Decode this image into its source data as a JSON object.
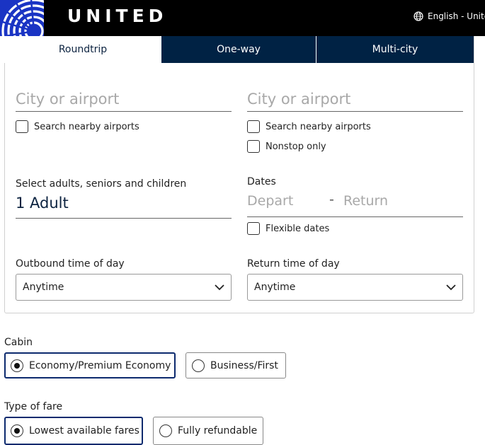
{
  "header": {
    "brand": "UNITED",
    "language": "English - United",
    "globe_icon": "globe-icon",
    "logo_icon": "united-globe-logo"
  },
  "colors": {
    "header_bg": "#000000",
    "logo_blue": "#1a34c4",
    "tab_inactive_bg": "#002244",
    "selected_border": "#0c2a6e",
    "placeholder": "#a8a8a8"
  },
  "tabs": [
    {
      "label": "Roundtrip",
      "active": true
    },
    {
      "label": "One-way",
      "active": false
    },
    {
      "label": "Multi-city",
      "active": false
    }
  ],
  "search": {
    "from": {
      "placeholder": "City or airport",
      "value": ""
    },
    "to": {
      "placeholder": "City or airport",
      "value": ""
    },
    "from_nearby": {
      "label": "Search nearby airports",
      "checked": false
    },
    "to_nearby": {
      "label": "Search nearby airports",
      "checked": false
    },
    "nonstop": {
      "label": "Nonstop only",
      "checked": false
    }
  },
  "travelers": {
    "label": "Select adults, seniors and children",
    "value": "1 Adult"
  },
  "dates": {
    "label": "Dates",
    "depart_placeholder": "Depart",
    "separator": "-",
    "return_placeholder": "Return",
    "flexible": {
      "label": "Flexible dates",
      "checked": false
    }
  },
  "outbound_time": {
    "label": "Outbound time of day",
    "selected": "Anytime"
  },
  "return_time": {
    "label": "Return time of day",
    "selected": "Anytime"
  },
  "cabin": {
    "label": "Cabin",
    "options": [
      {
        "label": "Economy/Premium Economy",
        "selected": true
      },
      {
        "label": "Business/First",
        "selected": false
      }
    ]
  },
  "fare": {
    "label": "Type of fare",
    "options": [
      {
        "label": "Lowest available fares",
        "selected": true
      },
      {
        "label": "Fully refundable",
        "selected": false
      }
    ]
  }
}
